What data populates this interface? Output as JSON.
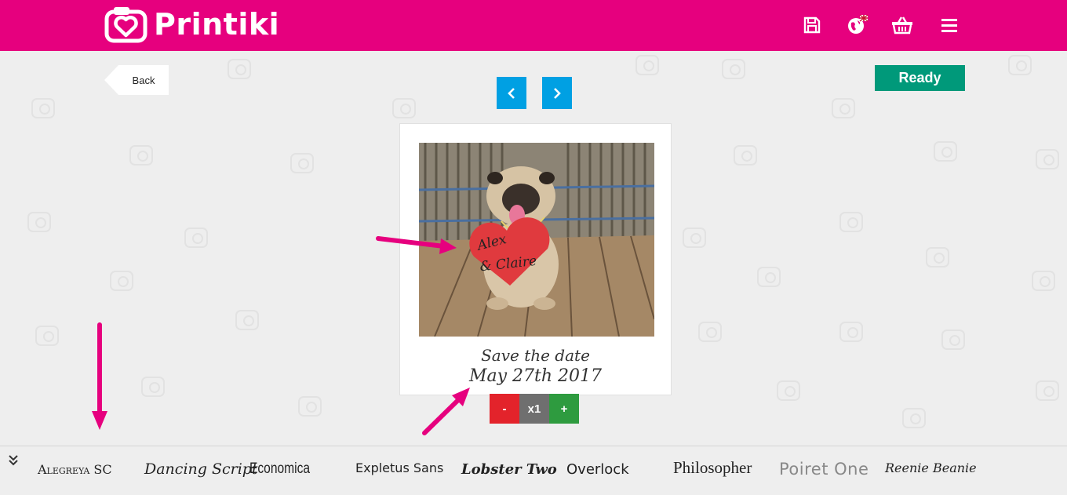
{
  "header": {
    "brand": "Printiki",
    "icons": [
      "save-icon",
      "language-globe-icon",
      "basket-icon",
      "menu-icon"
    ],
    "background": "#e6007e"
  },
  "toolbar": {
    "back_label": "Back",
    "ready_label": "Ready",
    "ready_color": "#00997a",
    "nav_color": "#00a0e3"
  },
  "card": {
    "heart_line1": "Alex",
    "heart_line2": "& Claire",
    "caption_line1": "Save the date",
    "caption_line2": "May 27th 2017"
  },
  "quantity": {
    "minus": "-",
    "value": "x1",
    "plus": "+"
  },
  "fonts": [
    {
      "label": "Alegreya SC"
    },
    {
      "label": "Dancing Script"
    },
    {
      "label": "Economica"
    },
    {
      "label": "Expletus Sans"
    },
    {
      "label": "Lobster Two"
    },
    {
      "label": "Overlock"
    },
    {
      "label": "Philosopher"
    },
    {
      "label": "Poiret One"
    },
    {
      "label": "Reenie Beanie"
    }
  ]
}
